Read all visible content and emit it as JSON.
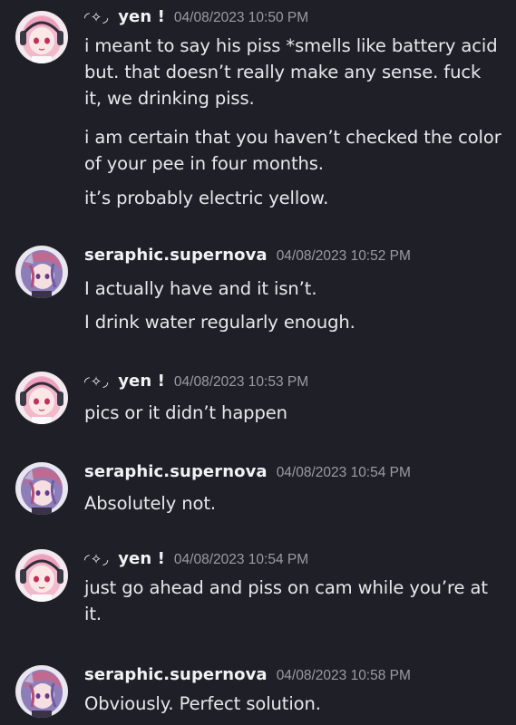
{
  "messages": [
    {
      "author": "yen !",
      "author_deco": "◜✧◞",
      "timestamp": "04/08/2023 10:50 PM",
      "avatar": "yen-avatar",
      "lines": [
        "i meant to say his piss *smells like battery acid but. that doesn’t really make any sense. fuck it, we drinking piss.",
        "i am certain that you haven’t checked the color of your pee in four months.",
        "it’s probably electric yellow."
      ]
    },
    {
      "author": "seraphic.supernova",
      "author_deco": "",
      "timestamp": "04/08/2023 10:52 PM",
      "avatar": "seraphic-avatar",
      "lines": [
        "I actually have and it isn’t.",
        "I drink water regularly enough."
      ]
    },
    {
      "author": "yen !",
      "author_deco": "◜✧◞",
      "timestamp": "04/08/2023 10:53 PM",
      "avatar": "yen-avatar",
      "lines": [
        "pics or it didn’t happen"
      ]
    },
    {
      "author": "seraphic.supernova",
      "author_deco": "",
      "timestamp": "04/08/2023 10:54 PM",
      "avatar": "seraphic-avatar",
      "lines": [
        "Absolutely not."
      ]
    },
    {
      "author": "yen !",
      "author_deco": "◜✧◞",
      "timestamp": "04/08/2023 10:54 PM",
      "avatar": "yen-avatar",
      "lines": [
        "just go ahead and piss on cam while you’re at it."
      ]
    },
    {
      "author": "seraphic.supernova",
      "author_deco": "",
      "timestamp": "04/08/2023 10:58 PM",
      "avatar": "seraphic-avatar",
      "lines": [
        "Obviously. Perfect solution."
      ]
    }
  ]
}
